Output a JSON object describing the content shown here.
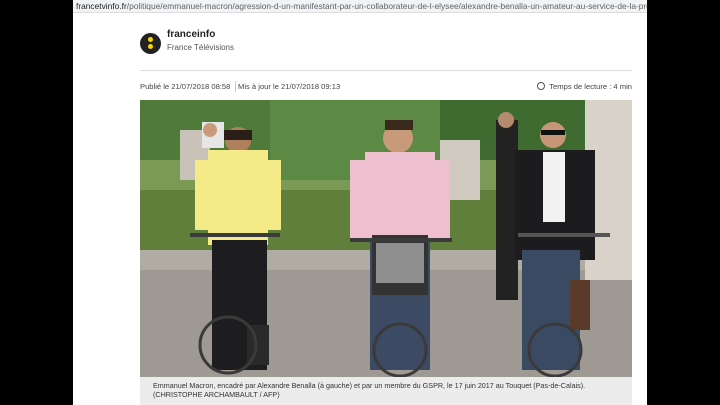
{
  "browser": {
    "url_domain": "francetvinfo.fr",
    "url_path": "/politique/emmanuel-macron/agression-d-un-manifestant-par-un-collaborateur-de-l-elysee/alexandre-benalla-un-amateur-au-service-de-la-protection-d-emmar"
  },
  "brand": {
    "name": "franceinfo",
    "sub": "France Télévisions"
  },
  "meta": {
    "published": "Publié le 21/07/2018 08:58",
    "updated": "Mis à jour le 21/07/2018 09:13",
    "reading_time": "Temps de lecture : 4 min"
  },
  "photo": {
    "caption": "Emmanuel Macron, encadré par Alexandre Benalla (à gauche) et par un membre du GSPR, le 17 juin 2017 au Touquet (Pas-de-Calais).",
    "credit": "(CHRISTOPHE ARCHAMBAULT / AFP)"
  },
  "colors": {
    "brand_yellow": "#ffd400",
    "brand_dark": "#222222",
    "caption_bg": "#ececec"
  }
}
